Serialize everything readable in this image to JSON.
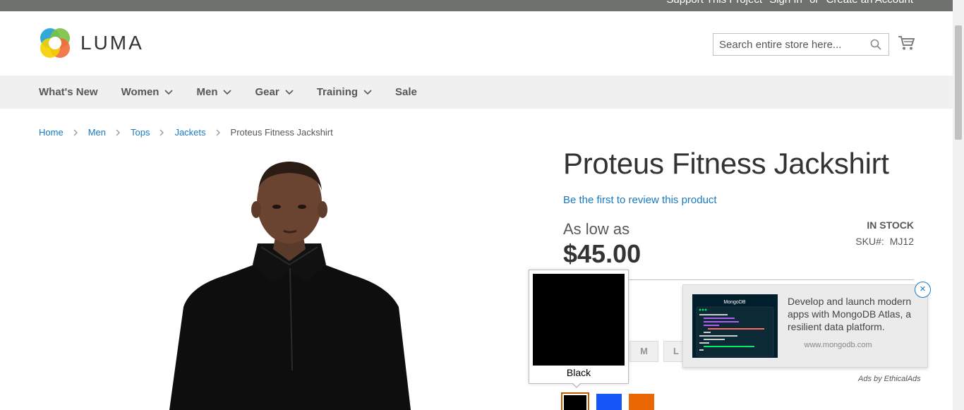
{
  "topbar": {
    "support_link": "Support This Project",
    "signin_link": "Sign In",
    "or_text": "or",
    "create_link": "Create an Account"
  },
  "header": {
    "logo_text": "LUMA",
    "search_placeholder": "Search entire store here..."
  },
  "nav": {
    "items": [
      {
        "label": "What's New",
        "has_dropdown": false
      },
      {
        "label": "Women",
        "has_dropdown": true
      },
      {
        "label": "Men",
        "has_dropdown": true
      },
      {
        "label": "Gear",
        "has_dropdown": true
      },
      {
        "label": "Training",
        "has_dropdown": true
      },
      {
        "label": "Sale",
        "has_dropdown": false
      }
    ]
  },
  "breadcrumb": {
    "items": [
      "Home",
      "Men",
      "Tops",
      "Jackets"
    ],
    "current": "Proteus Fitness Jackshirt"
  },
  "product": {
    "title": "Proteus Fitness Jackshirt",
    "review_link": "Be the first to review this product",
    "price_prefix": "As low as",
    "price": "$45.00",
    "stock": "IN STOCK",
    "sku_label": "SKU#:",
    "sku_value": "MJ12",
    "sizes": [
      "M",
      "L"
    ],
    "colors": [
      {
        "name": "Black",
        "hex": "#000000"
      },
      {
        "name": "Blue",
        "hex": "#1857f7"
      },
      {
        "name": "Orange",
        "hex": "#eb6703"
      }
    ],
    "swatch_tooltip": "Black"
  },
  "ad": {
    "text": "Develop and launch modern apps with MongoDB Atlas, a resilient data platform.",
    "url": "www.mongodb.com",
    "close_label": "×",
    "attribution": "Ads by EthicalAds",
    "image_brand": "MongoDB"
  },
  "colors": {
    "link": "#1979c3",
    "nav_bg": "#f0f0f0",
    "topbar_bg": "#6e716e"
  }
}
